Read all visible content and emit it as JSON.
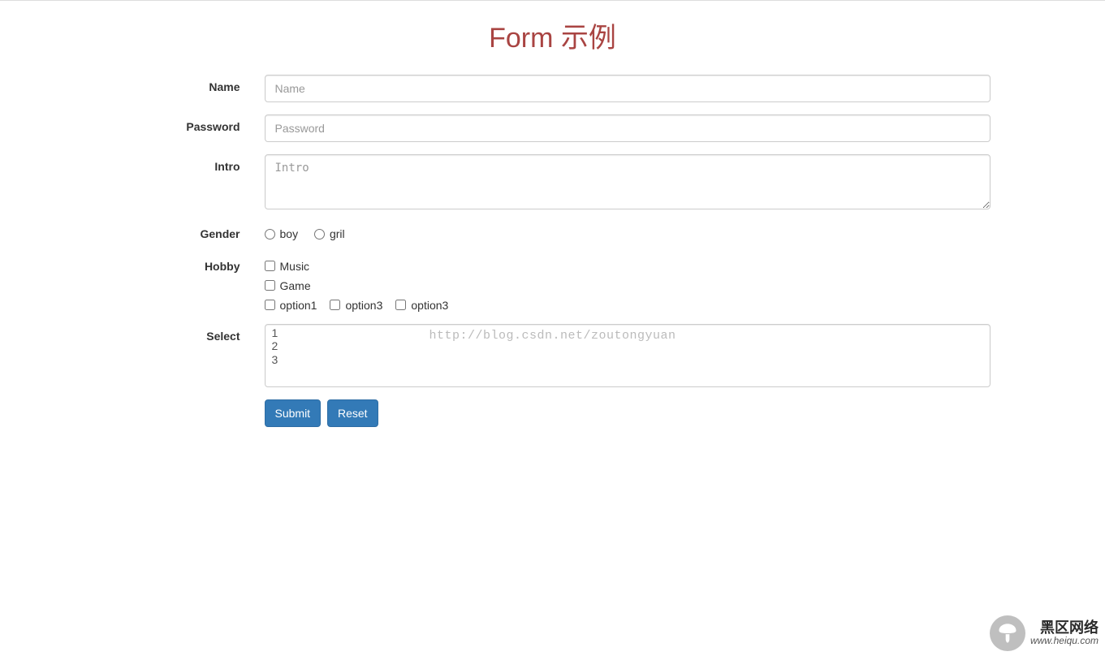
{
  "page": {
    "title": "Form 示例"
  },
  "form": {
    "name": {
      "label": "Name",
      "placeholder": "Name",
      "value": ""
    },
    "password": {
      "label": "Password",
      "placeholder": "Password",
      "value": ""
    },
    "intro": {
      "label": "Intro",
      "placeholder": "Intro",
      "value": ""
    },
    "gender": {
      "label": "Gender",
      "options": [
        {
          "label": "boy"
        },
        {
          "label": "gril"
        }
      ]
    },
    "hobby": {
      "label": "Hobby",
      "stacked": [
        {
          "label": "Music"
        },
        {
          "label": "Game"
        }
      ],
      "inline": [
        {
          "label": "option1"
        },
        {
          "label": "option3"
        },
        {
          "label": "option3"
        }
      ]
    },
    "select": {
      "label": "Select",
      "options": [
        "1",
        "2",
        "3"
      ]
    },
    "buttons": {
      "submit": "Submit",
      "reset": "Reset"
    }
  },
  "watermark": "http://blog.csdn.net/zoutongyuan",
  "footer": {
    "cn": "黑区网络",
    "en": "www.heiqu.com"
  }
}
